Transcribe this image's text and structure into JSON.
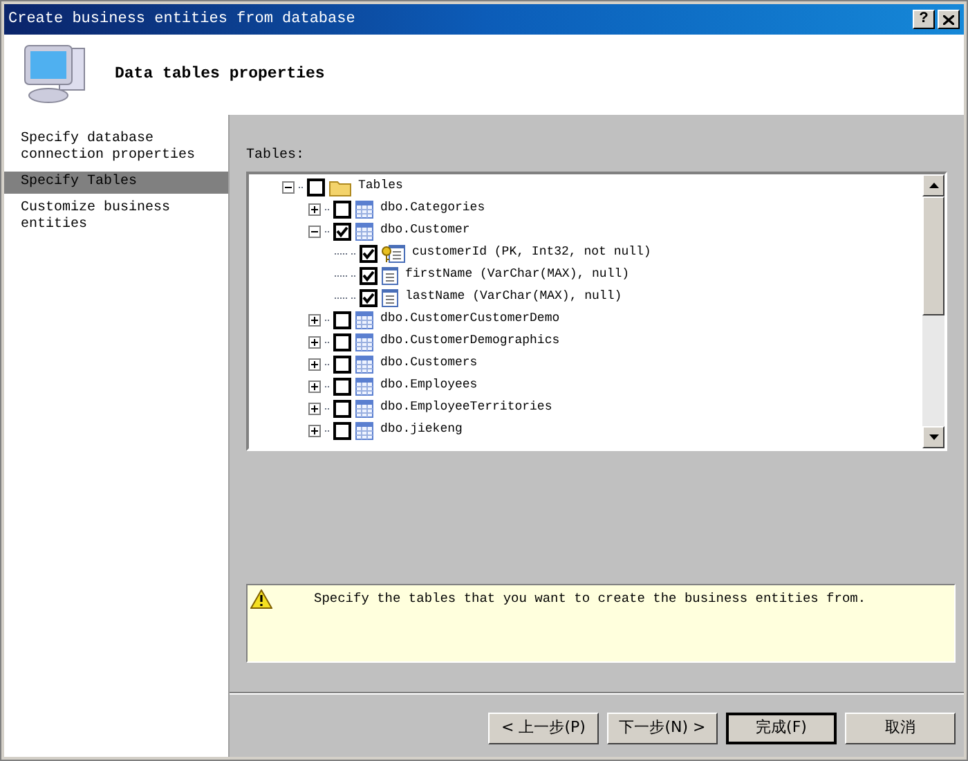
{
  "window": {
    "title": "Create business entities from database",
    "help": "?"
  },
  "header": {
    "title": "Data tables properties"
  },
  "steps": [
    {
      "label": "Specify database connection properties",
      "selected": false
    },
    {
      "label": "Specify Tables",
      "selected": true
    },
    {
      "label": "Customize business entities",
      "selected": false
    }
  ],
  "tables_label": "Tables:",
  "tree": {
    "label": "Tables",
    "kind": "folder",
    "checked": false,
    "expanded": true,
    "children": [
      {
        "label": "dbo.Categories",
        "kind": "table",
        "checked": false,
        "expanded": false
      },
      {
        "label": "dbo.Customer",
        "kind": "table",
        "checked": true,
        "expanded": true,
        "children": [
          {
            "label": "customerId (PK, Int32, not null)",
            "kind": "key",
            "checked": true
          },
          {
            "label": "firstName (VarChar(MAX), null)",
            "kind": "column",
            "checked": true
          },
          {
            "label": "lastName (VarChar(MAX), null)",
            "kind": "column",
            "checked": true
          }
        ]
      },
      {
        "label": "dbo.CustomerCustomerDemo",
        "kind": "table",
        "checked": false,
        "expanded": false
      },
      {
        "label": "dbo.CustomerDemographics",
        "kind": "table",
        "checked": false,
        "expanded": false
      },
      {
        "label": "dbo.Customers",
        "kind": "table",
        "checked": false,
        "expanded": false
      },
      {
        "label": "dbo.Employees",
        "kind": "table",
        "checked": false,
        "expanded": false
      },
      {
        "label": "dbo.EmployeeTerritories",
        "kind": "table",
        "checked": false,
        "expanded": false
      },
      {
        "label": "dbo.jiekeng",
        "kind": "table",
        "checked": false,
        "expanded": false
      }
    ]
  },
  "message": "Specify the tables that you want to create the business entities from.",
  "buttons": [
    {
      "label": "< 上一步(P)",
      "default": false
    },
    {
      "label": "下一步(N) >",
      "default": false
    },
    {
      "label": "完成(F)",
      "default": true
    },
    {
      "label": "取消",
      "default": false
    }
  ]
}
